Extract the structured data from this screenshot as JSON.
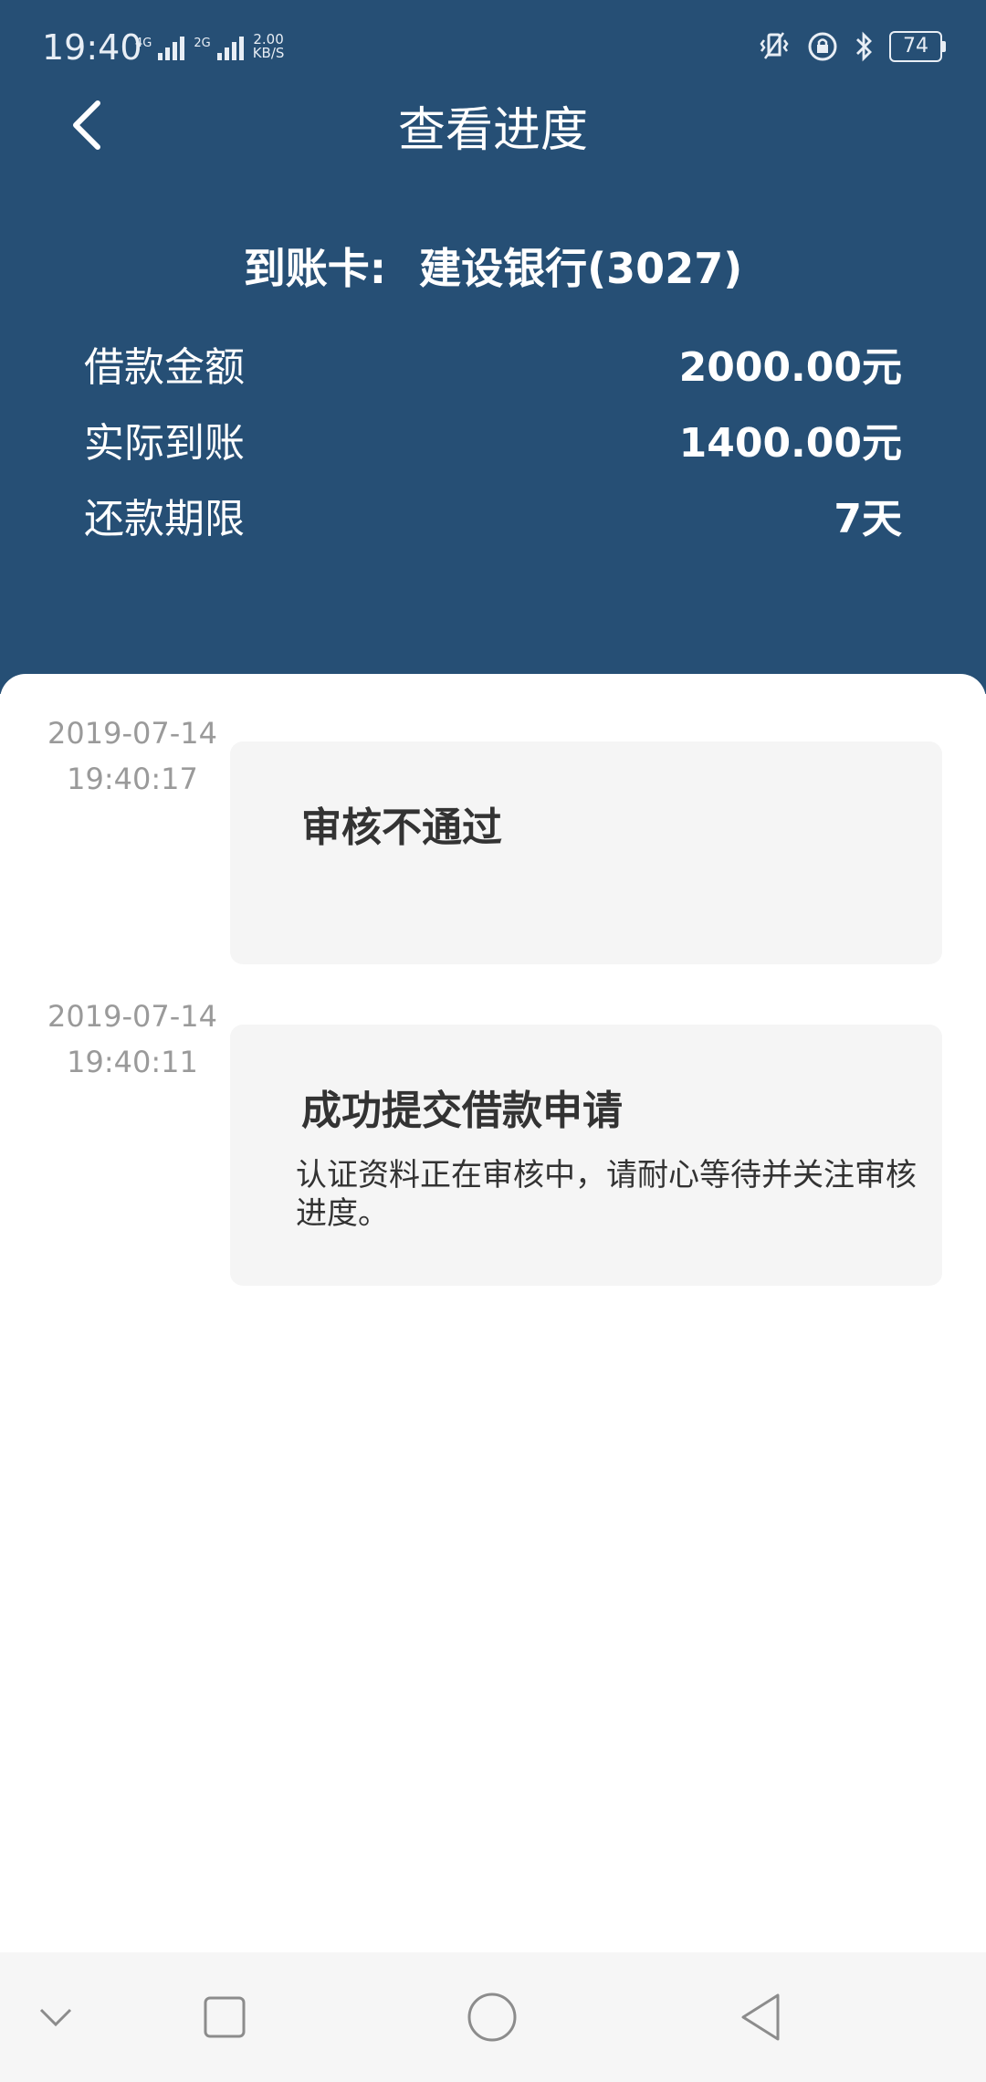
{
  "status": {
    "time": "19:40",
    "net1": "4G",
    "net2": "2G",
    "speed_value": "2.00",
    "speed_unit": "KB/S",
    "battery": "74"
  },
  "header": {
    "title": "查看进度",
    "card_label": "到账卡:",
    "card_value": "建设银行(3027)"
  },
  "info": [
    {
      "label": "借款金额",
      "value": "2000.00元"
    },
    {
      "label": "实际到账",
      "value": "1400.00元"
    },
    {
      "label": "还款期限",
      "value": "7天"
    }
  ],
  "timeline": [
    {
      "date": "2019-07-14",
      "time": "19:40:17",
      "title": "审核不通过",
      "desc": ""
    },
    {
      "date": "2019-07-14",
      "time": "19:40:11",
      "title": "成功提交借款申请",
      "desc": "认证资料正在审核中，请耐心等待并关注审核进度。"
    }
  ],
  "colors": {
    "header_bg": "#264f75",
    "card_bg": "#f5f5f5",
    "time_text": "#9a9a9a",
    "nav_bg": "#f6f6f6"
  },
  "icons": {
    "back": "chevron-left-icon",
    "nav_down": "chevron-down-icon",
    "nav_recent": "square-icon",
    "nav_home": "circle-icon",
    "nav_back": "triangle-back-icon"
  }
}
